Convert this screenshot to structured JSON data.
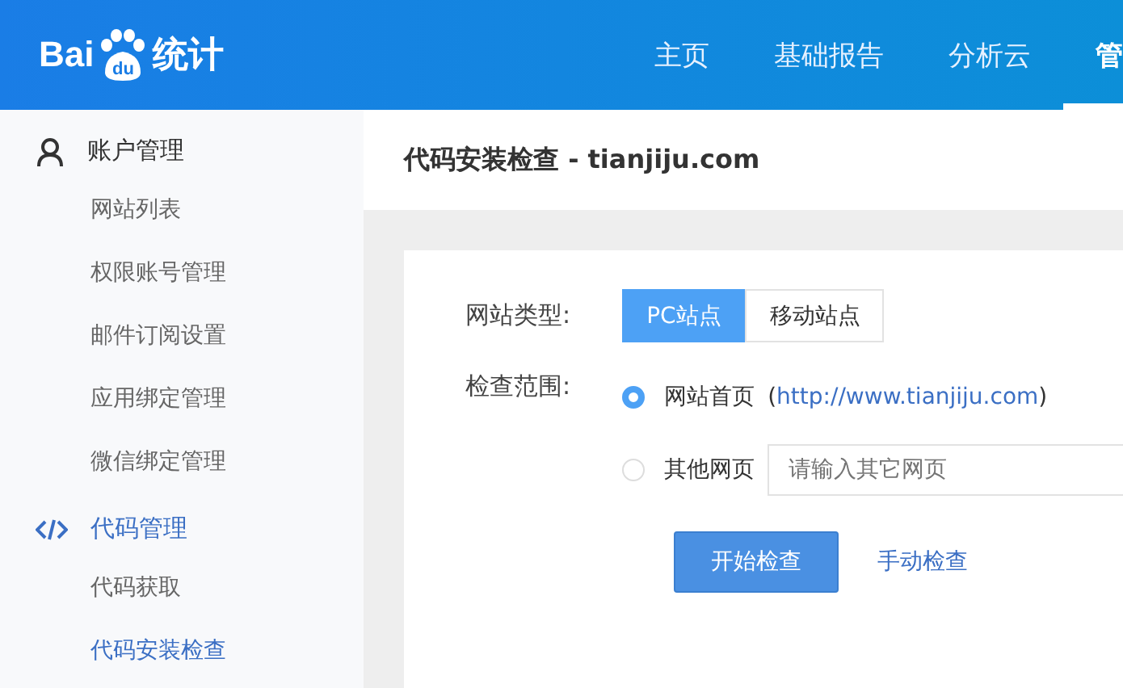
{
  "logo": {
    "part_1": "Bai",
    "part_2": "du",
    "part_3": "统计"
  },
  "nav": [
    {
      "label": "主页",
      "selected": false
    },
    {
      "label": "基础报告",
      "selected": false
    },
    {
      "label": "分析云",
      "selected": false
    },
    {
      "label": "管",
      "selected": true
    }
  ],
  "sidebar": [
    {
      "label": "账户管理",
      "kind": "account",
      "selected": false,
      "children": [
        {
          "label": "网站列表",
          "selected": false
        },
        {
          "label": "权限账号管理",
          "selected": false
        },
        {
          "label": "邮件订阅设置",
          "selected": false
        },
        {
          "label": "应用绑定管理",
          "selected": false
        },
        {
          "label": "微信绑定管理",
          "selected": false
        }
      ]
    },
    {
      "label": "代码管理",
      "kind": "code",
      "selected": true,
      "children": [
        {
          "label": "代码获取",
          "selected": false
        },
        {
          "label": "代码安装检查",
          "selected": true
        }
      ]
    }
  ],
  "page_title": "代码安装检查 - tianjiju.com",
  "form": {
    "site_type_label": "网站类型:",
    "site_types": [
      {
        "label": "PC站点",
        "selected": true
      },
      {
        "label": "移动站点",
        "selected": false
      }
    ],
    "scope_label": "检查范围:",
    "scopes": [
      {
        "kind": "home",
        "label": "网站首页",
        "selected": true,
        "open": "(",
        "url": "http://www.tianjiju.com",
        "close": ")"
      },
      {
        "kind": "other",
        "label": "其他网页",
        "selected": false,
        "placeholder": "请输入其它网页"
      }
    ],
    "start_button": "开始检查",
    "manual_link": "手动检查"
  }
}
